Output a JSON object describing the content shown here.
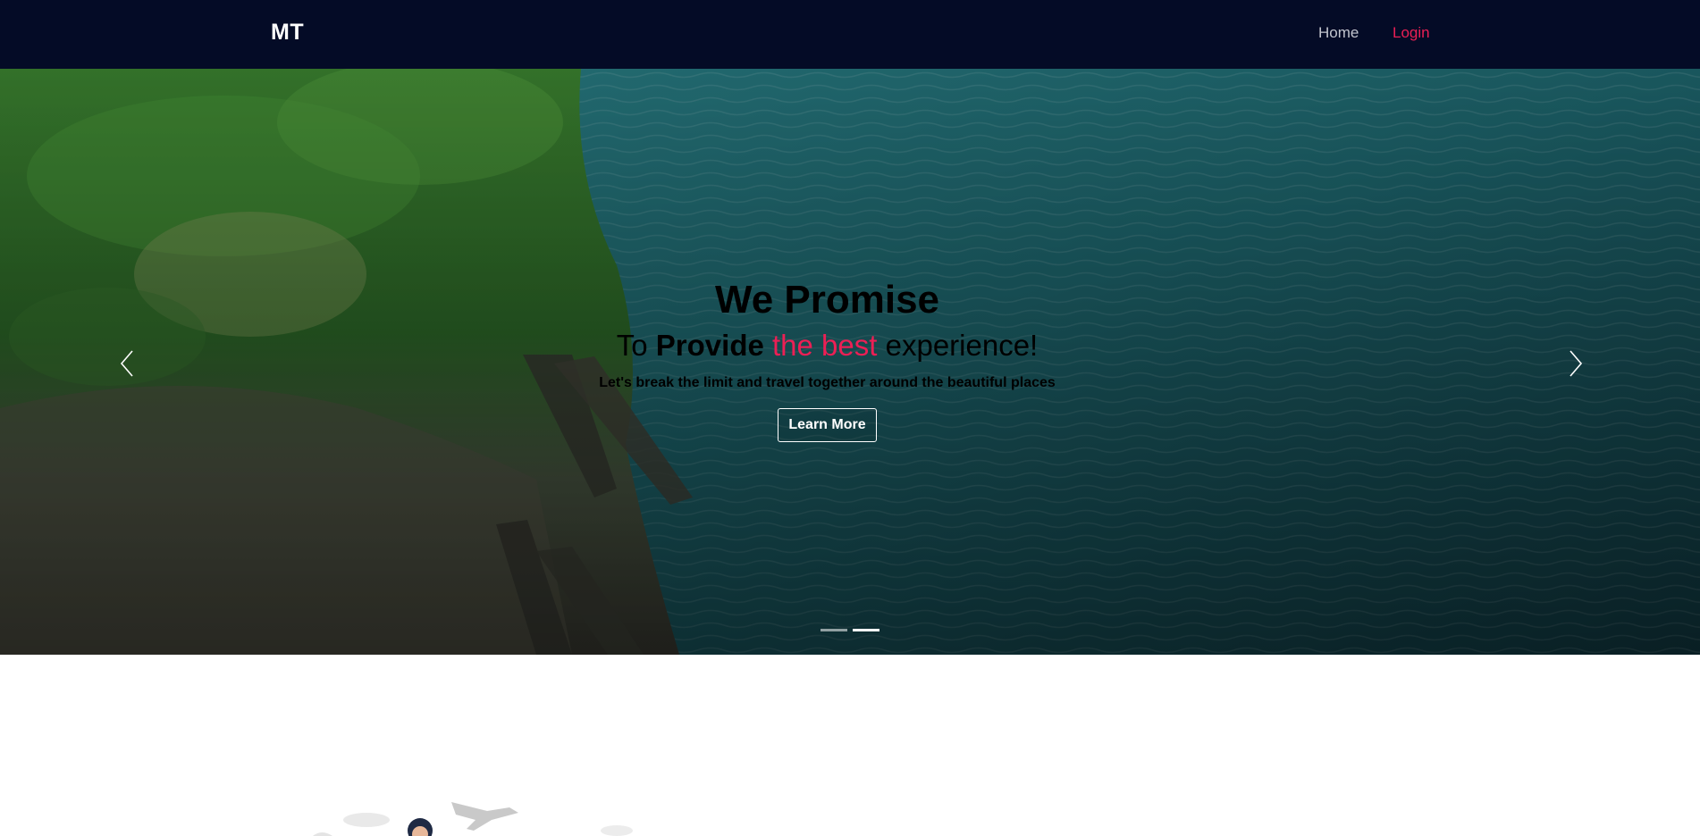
{
  "navbar": {
    "brand": "MT",
    "links": [
      {
        "label": "Home"
      },
      {
        "label": "Login"
      }
    ],
    "background": "#040b26",
    "active_color": "#ec1f55"
  },
  "hero": {
    "title": "We Promise",
    "subtitle": {
      "part1": "To",
      "part2": "Provide",
      "accent": "the best",
      "part3": "experience!"
    },
    "text": "Let's break the limit and travel together around the beautiful places",
    "button_label": "Learn More",
    "indicators": {
      "count": 2,
      "active": 2
    },
    "accent_color": "#ec1f55"
  },
  "icons": {
    "prev": "chevron-left-icon",
    "next": "chevron-right-icon"
  }
}
